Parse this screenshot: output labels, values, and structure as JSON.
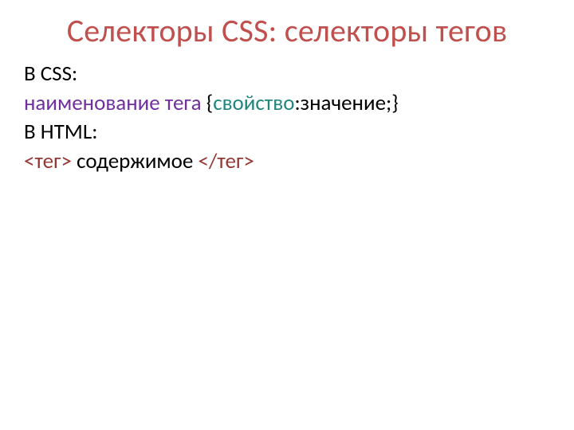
{
  "title": "Селекторы CSS: селекторы тегов",
  "body": {
    "line1": "В CSS:",
    "line2": {
      "tagname": "наименование тега ",
      "open_brace": "{",
      "property": "свойство",
      "after_property": ":значение;}"
    },
    "line3": "В HTML:",
    "line4": {
      "open_lt": "<",
      "open_tag": "тег",
      "open_gt": "> ",
      "content": "содержимое ",
      "close_lt": "<",
      "close_tag": "/тег",
      "close_gt": ">"
    }
  }
}
